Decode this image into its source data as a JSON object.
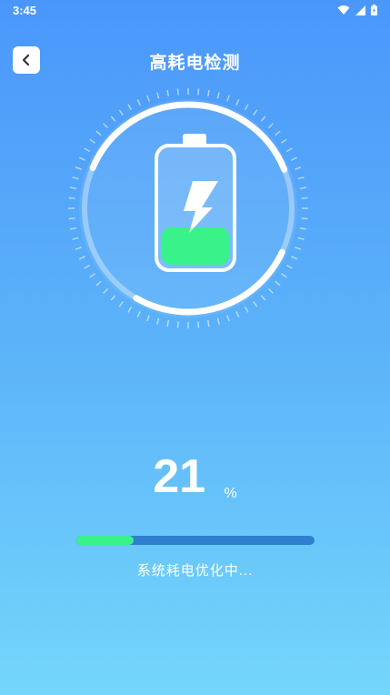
{
  "status_bar": {
    "time": "3:45",
    "icons": [
      "wifi-icon",
      "signal-icon",
      "battery-icon"
    ]
  },
  "header": {
    "title": "高耗电检测",
    "back_icon": "chevron-left-icon"
  },
  "gauge": {
    "battery_level": 0.21,
    "colors": {
      "ring": "#ffffff",
      "fill": "#39f28a",
      "bolt": "#ffffff"
    }
  },
  "result": {
    "percent": "21",
    "unit": "%"
  },
  "progress": {
    "value": 0.24,
    "text": "系统耗电优化中..."
  },
  "colors": {
    "bg_top": "#4a97fb",
    "bg_bottom": "#74d6fb",
    "accent": "#39f28a",
    "track": "#2f7fd0"
  }
}
